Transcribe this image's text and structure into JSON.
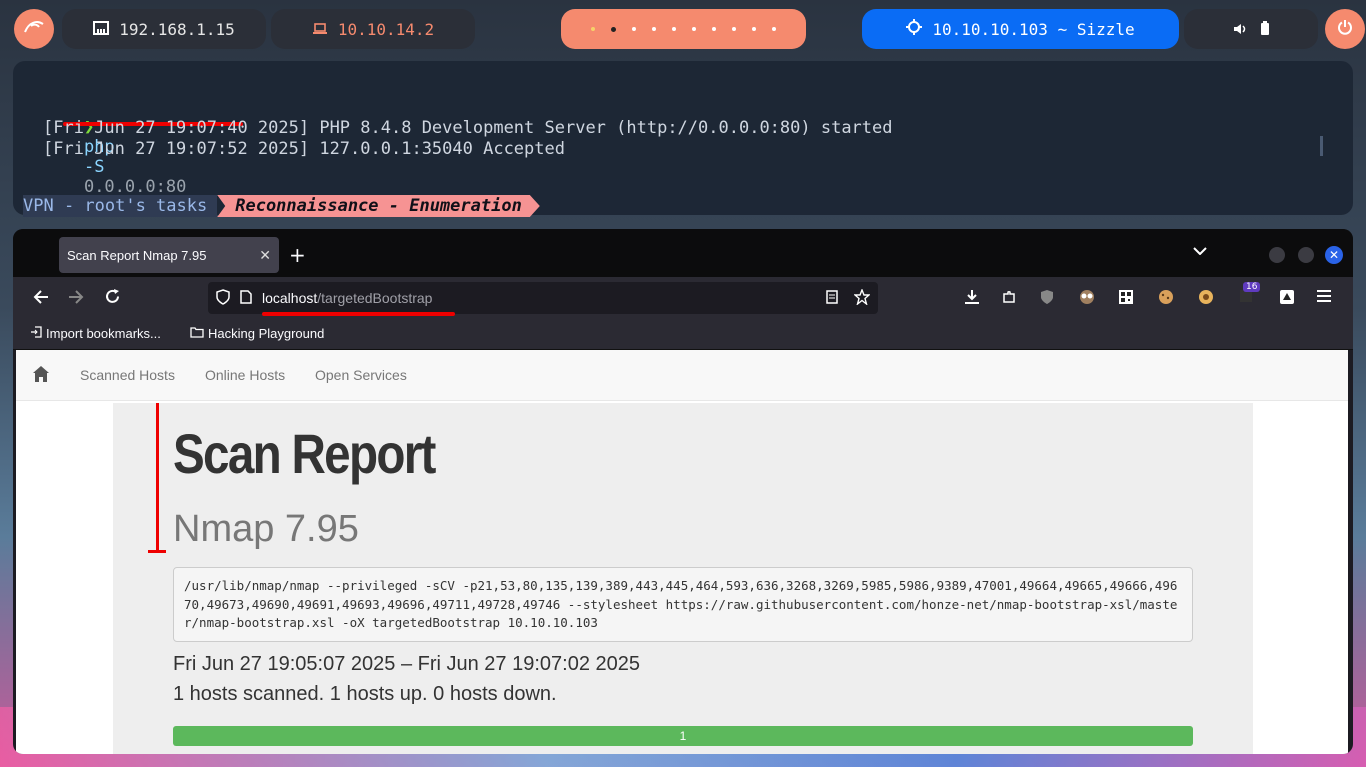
{
  "topbar": {
    "local_ip": "192.168.1.15",
    "vpn_ip": "10.10.14.2",
    "target": "10.10.10.103 ~ Sizzle"
  },
  "terminal": {
    "prompt_symbol": "❯",
    "cmd": "php",
    "cmd_flag": "-S",
    "cmd_arg": "0.0.0.0:80",
    "line1": "[Fri Jun 27 19:07:40 2025] PHP 8.4.8 Development Server (http://0.0.0.0:80) started",
    "line2": "[Fri Jun 27 19:07:52 2025] 127.0.0.1:35040 Accepted",
    "status_left": "VPN - root's tasks",
    "status_right": "Reconnaissance - Enumeration"
  },
  "browser": {
    "tab_title": "Scan Report Nmap 7.95",
    "url_host": "localhost",
    "url_path": "/targetedBootstrap",
    "badge_count": "16",
    "bookmarks": [
      "Import bookmarks...",
      "Hacking Playground"
    ]
  },
  "page": {
    "nav": [
      "Scanned Hosts",
      "Online Hosts",
      "Open Services"
    ],
    "title": "Scan Report",
    "subtitle": "Nmap 7.95",
    "command": "/usr/lib/nmap/nmap --privileged -sCV -p21,53,80,135,139,389,443,445,464,593,636,3268,3269,5985,5986,9389,47001,49664,49665,49666,49670,49673,49690,49691,49693,49696,49711,49728,49746 --stylesheet https://raw.githubusercontent.com/honze-net/nmap-bootstrap-xsl/master/nmap-bootstrap.xsl -oX targetedBootstrap 10.10.10.103",
    "dates": "Fri Jun 27 19:05:07 2025 – Fri Jun 27 19:07:02 2025",
    "hosts": "1 hosts scanned. 1 hosts up. 0 hosts down.",
    "progress_label": "1",
    "progress_fraction": 1.0
  }
}
